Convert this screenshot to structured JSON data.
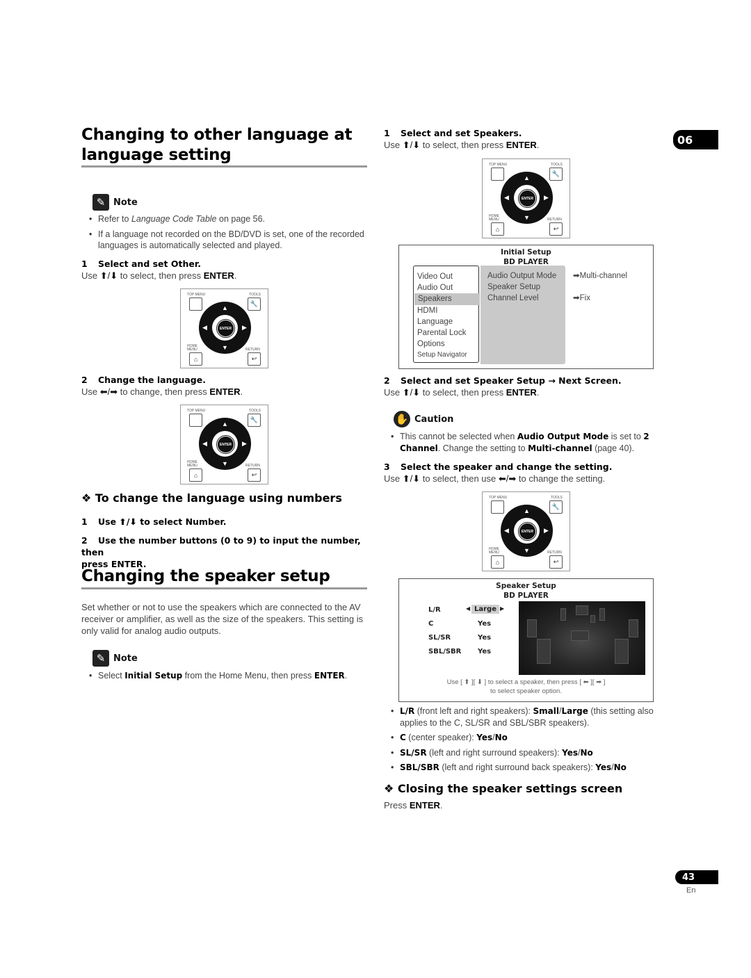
{
  "chapter_tab": "06",
  "page": {
    "number": "43",
    "lang": "En"
  },
  "left": {
    "section1": {
      "title_line1": "Changing to other language at",
      "title_line2": "language setting",
      "note_label": "Note",
      "notes": [
        {
          "pre": "Refer to ",
          "em": "Language Code Table",
          "post": " on page 56."
        },
        {
          "text": "If a language not recorded on the BD/DVD is set, one of the recorded languages is automatically selected and played."
        }
      ],
      "step1": {
        "num": "1",
        "title": "Select and set Other.",
        "pre": "Use ",
        "arrows": "⬆/⬇",
        "mid": " to select, then press ",
        "key": "ENTER",
        "post": "."
      },
      "step2": {
        "num": "2",
        "title": "Change the language.",
        "pre": "Use ",
        "arrows": "⬅/➡",
        "mid": " to change, then press ",
        "key": "ENTER",
        "post": "."
      },
      "subsection": {
        "marker": "❖",
        "title": "To change the language using numbers",
        "step1": {
          "num": "1",
          "text": "Use ⬆/⬇ to select Number."
        },
        "step2": {
          "num": "2",
          "text": "Use the number buttons (0 to 9) to input the number, then",
          "text2": "press ENTER."
        }
      }
    },
    "section2": {
      "title": "Changing the speaker setup",
      "body": "Set whether or not to use the speakers which are connected to the AV receiver or amplifier, as well as the size of the speakers. This setting is only valid for analog audio outputs.",
      "note_label": "Note",
      "note": {
        "pre": "Select ",
        "b1": "Initial Setup",
        "mid": " from the Home Menu, then press ",
        "b2": "ENTER",
        "post": "."
      }
    }
  },
  "remote": {
    "top_menu": "TOP MENU",
    "tools": "TOOLS",
    "home_menu_1": "HOME",
    "home_menu_2": "MENU",
    "return": "RETURN",
    "enter": "ENTER"
  },
  "right": {
    "step1": {
      "num": "1",
      "title": "Select and set Speakers.",
      "pre": "Use ",
      "arrows": "⬆/⬇",
      "mid": " to select, then press ",
      "key": "ENTER",
      "post": "."
    },
    "initial_setup": {
      "title1": "Initial Setup",
      "title2": "BD PLAYER",
      "left_menu": [
        "Video Out",
        "Audio Out",
        "Speakers",
        "HDMI",
        "Language",
        "Parental Lock",
        "Options",
        "Setup Navigator"
      ],
      "selected": "Speakers",
      "mid_menu": [
        "Audio Output Mode",
        "Speaker Setup",
        "Channel Level"
      ],
      "values": [
        "➡Multi-channel",
        "",
        "➡Fix"
      ]
    },
    "step2": {
      "num": "2",
      "title": "Select and set Speaker Setup → Next Screen.",
      "pre": "Use ",
      "arrows": "⬆/⬇",
      "mid": " to select, then press ",
      "key": "ENTER",
      "post": "."
    },
    "caution": {
      "label": "Caution",
      "pre": "This cannot be selected when ",
      "b1": "Audio Output Mode",
      "mid1": " is set to ",
      "b2": "2 Channel",
      "mid2": ". Change the setting to ",
      "b3": "Multi-channel",
      "post": " (page 40)."
    },
    "step3": {
      "num": "3",
      "title": "Select the speaker and change the setting.",
      "pre": "Use ",
      "arrows1": "⬆/⬇",
      "mid": " to select, then use ",
      "arrows2": "⬅/➡",
      "post": " to change the setting."
    },
    "speaker_setup": {
      "title1": "Speaker Setup",
      "title2": "BD PLAYER",
      "rows": [
        {
          "name": "L/R",
          "value": "Large",
          "selected": true
        },
        {
          "name": "C",
          "value": "Yes"
        },
        {
          "name": "SL/SR",
          "value": "Yes"
        },
        {
          "name": "SBL/SBR",
          "value": "Yes"
        }
      ],
      "hint1": "Use [ ⬆ ][ ⬇ ] to select a speaker, then press [ ⬅ ][ ➡ ]",
      "hint2": "to select speaker option."
    },
    "options": [
      {
        "b": "L/R",
        "t": " (front left and right speakers): ",
        "v1": "Small",
        "sep": "/",
        "v2": "Large",
        "post": " (this setting also applies to the C, SL/SR and SBL/SBR speakers)."
      },
      {
        "b": "C",
        "t": " (center speaker): ",
        "v1": "Yes",
        "sep": "/",
        "v2": "No",
        "post": ""
      },
      {
        "b": "SL/SR",
        "t": " (left and right surround speakers): ",
        "v1": "Yes",
        "sep": "/",
        "v2": "No",
        "post": ""
      },
      {
        "b": "SBL/SBR",
        "t": " (left and right surround back speakers): ",
        "v1": "Yes",
        "sep": "/",
        "v2": "No",
        "post": ""
      }
    ],
    "closing": {
      "marker": "❖",
      "title": "Closing the speaker settings screen",
      "pre": "Press ",
      "key": "ENTER",
      "post": "."
    }
  }
}
